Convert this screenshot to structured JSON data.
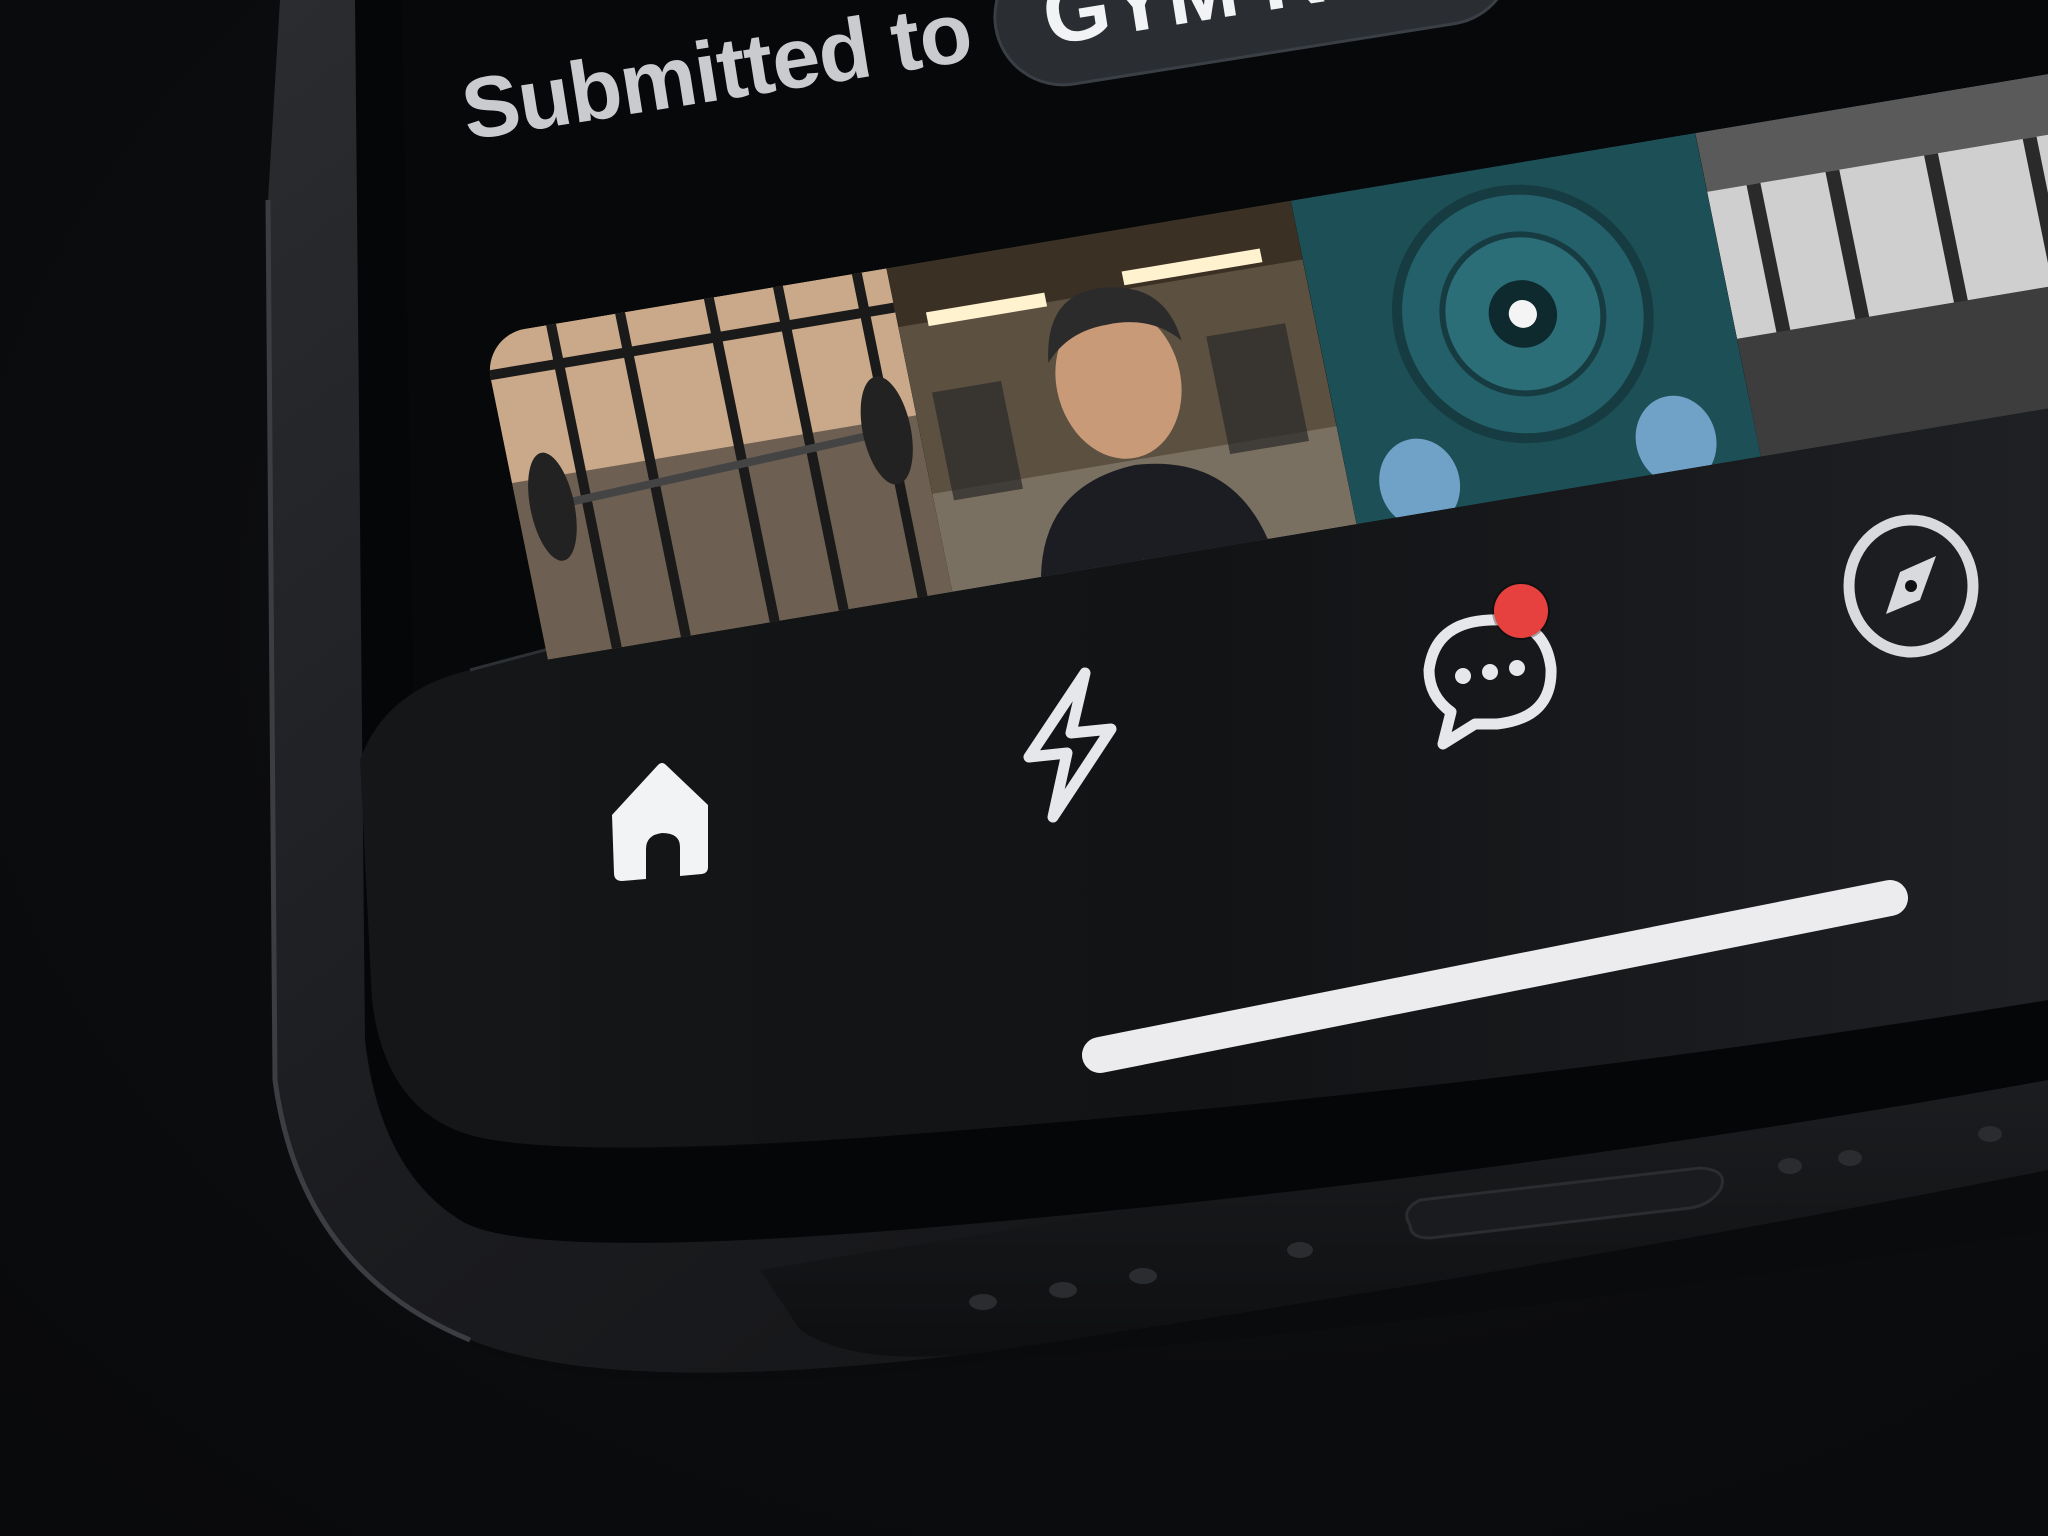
{
  "header": {
    "submitted_prefix": "Submitted to",
    "group_name": "GYM Rout"
  },
  "photos": [
    {
      "name": "squat-rack-window"
    },
    {
      "name": "gym-selfie"
    },
    {
      "name": "weight-plate"
    },
    {
      "name": "gym-interior-bw"
    }
  ],
  "tab_bar": {
    "items": [
      {
        "icon": "home-icon",
        "active": true
      },
      {
        "icon": "lightning-icon",
        "active": false
      },
      {
        "icon": "chat-bubble-icon",
        "active": false,
        "badge": true
      },
      {
        "icon": "compass-icon",
        "active": false
      }
    ],
    "badge_color": "#e6413f",
    "accent": "#f2f3f5"
  }
}
